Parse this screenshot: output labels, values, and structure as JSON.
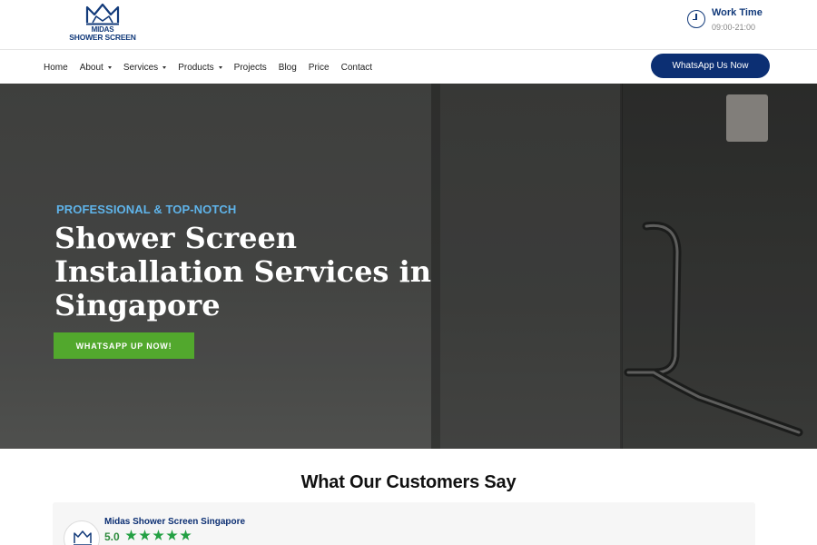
{
  "header": {
    "logo_line1": "MIDAS",
    "logo_line2": "SHOWER SCREEN",
    "work_time_label": "Work Time",
    "work_time_hours": "09:00-21:00",
    "icons": {
      "logo": "crown-icon",
      "work_time": "clock-icon"
    }
  },
  "nav": {
    "items": [
      {
        "label": "Home",
        "dropdown": false
      },
      {
        "label": "About",
        "dropdown": true
      },
      {
        "label": "Services",
        "dropdown": true
      },
      {
        "label": "Products",
        "dropdown": true
      },
      {
        "label": "Projects",
        "dropdown": false
      },
      {
        "label": "Blog",
        "dropdown": false
      },
      {
        "label": "Price",
        "dropdown": false
      },
      {
        "label": "Contact",
        "dropdown": false
      }
    ],
    "whatsapp_button": "WhatsApp Us Now"
  },
  "hero": {
    "eyebrow": "PROFESSIONAL & TOP-NOTCH",
    "title": "Shower Screen Installation Services in Singapore",
    "cta_label": "WHATSAPP UP NOW!"
  },
  "reviews": {
    "section_title": "What Our Customers Say",
    "business_name": "Midas Shower Screen Singapore",
    "rating": "5.0",
    "stars": 5
  },
  "colors": {
    "brand_navy": "#0c2f73",
    "accent_blue": "#5fb4ea",
    "cta_green": "#52a82d",
    "star_green": "#23a043"
  }
}
